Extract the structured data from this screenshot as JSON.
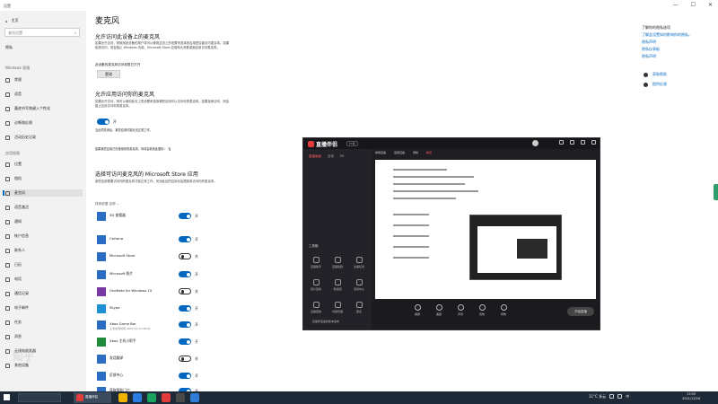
{
  "window": {
    "title": "设置",
    "controls": [
      "—",
      "☐",
      "✕"
    ]
  },
  "sidebar": {
    "home": "主页",
    "search_placeholder": "查找设置",
    "category": "隐私",
    "group_windows": "Windows 权限",
    "windows_items": [
      "常规",
      "语音",
      "墨迹书写和键入个性化",
      "诊断和反馈",
      "活动历史记录"
    ],
    "group_apps": "应用权限",
    "app_items": [
      "位置",
      "相机",
      "麦克风",
      "语音激活",
      "通知",
      "帐户信息",
      "联系人",
      "日历",
      "电话",
      "通话记录",
      "电子邮件",
      "任务",
      "消息",
      "无线电收发器",
      "其他设备"
    ],
    "active_index": 2
  },
  "main": {
    "title": "麦克风",
    "sec1_heading": "允许访问此设备上的麦克风",
    "sec1_text": "如果允许访问，则使用此设备的用户将可以使用这页上的设置来选择其应用是否能访问麦克风。如果拒绝访问，则会阻止 Windows 功能、Microsoft Store 应用和大多数桌面应用访问麦克风。",
    "sec1_status": "此设备的麦克风访问权限已打开",
    "change_button": "更改",
    "sec2_heading": "允许应用访问你的麦克风",
    "sec2_text": "如果允许访问，则可以使用此页上的设置来选择哪些应用可以访问你的麦克风。如果拒绝访问，则会阻止应用访问你的麦克风。",
    "sec2_toggle_state": "开",
    "sec2_note1": "当此项关闭后，某些应用可能无法正常工作。",
    "sec2_note2": "如果某些应用已在使用你的麦克风，你将会看到此图标：",
    "sec3_heading": "选择可访问麦克风的 Microsoft Store 应用",
    "sec3_text": "某些应用需要访问你的麦克风才能正常工作。关闭此处的应用也会限制其访问你的麦克风。",
    "sort_label": "排序依据  名称",
    "apps": [
      {
        "name": "3D 查看器",
        "sub": "",
        "state": "开",
        "on": true,
        "color": "#2b6cc4"
      },
      {
        "name": "Cortana",
        "sub": "",
        "state": "开",
        "on": true,
        "color": "#2b6cc4"
      },
      {
        "name": "Microsoft Store",
        "sub": "",
        "state": "关",
        "on": false,
        "color": "#2b6cc4"
      },
      {
        "name": "Microsoft 照片",
        "sub": "",
        "state": "开",
        "on": true,
        "color": "#2b6cc4"
      },
      {
        "name": "OneNote for Windows 10",
        "sub": "",
        "state": "关",
        "on": false,
        "color": "#7a3aa6"
      },
      {
        "name": "Skype",
        "sub": "",
        "state": "开",
        "on": true,
        "color": "#1f8fd6"
      },
      {
        "name": "Xbox Game Bar",
        "sub": "上次访问时间 2021/11 21:28:21",
        "state": "开",
        "on": true,
        "color": "#2b6cc4"
      },
      {
        "name": "Xbox 主机小帮手",
        "sub": "",
        "state": "开",
        "on": true,
        "color": "#1e8a3a"
      },
      {
        "name": "发话翻译",
        "sub": "",
        "state": "关",
        "on": false,
        "color": "#2b6cc4"
      },
      {
        "name": "反馈中心",
        "sub": "",
        "state": "开",
        "on": true,
        "color": "#2b6cc4"
      },
      {
        "name": "获取帮助门户",
        "sub": "",
        "state": "开",
        "on": true,
        "color": "#2b6cc4"
      }
    ]
  },
  "right_panel": {
    "head": "了解你的隐私选项",
    "links": [
      "了解此设置如何影响你的隐私。",
      "隐私声明",
      "隐私仪表板",
      "隐私声明"
    ],
    "help": [
      "获取帮助",
      "提供反馈"
    ]
  },
  "stream_app": {
    "logo": "直播伴侣",
    "version": "PC版",
    "left_tabs": [
      "直播画面",
      "互动",
      "PK"
    ],
    "tools_header": "工具箱",
    "tools": [
      "直播助手",
      "直播奖励",
      "主播任务",
      "观众连线",
      "粉丝团",
      "活动中心",
      "直播回放",
      "内容管理",
      "更多"
    ],
    "bottom_note": "· 直播伴侣最新版本发布",
    "stage_tabs": [
      "横屏直播",
      "竖屏直播",
      "录制",
      "推流"
    ],
    "bottom_buttons": [
      "横屏",
      "美颜",
      "声音",
      "音效",
      "特效"
    ],
    "start_button": "开始直播"
  },
  "taskbar": {
    "active_app": "直播伴侣",
    "weather": "11°C 多云",
    "ime": "中",
    "time": "13:55",
    "date": "2021/12/16"
  },
  "watermark": "知乎"
}
